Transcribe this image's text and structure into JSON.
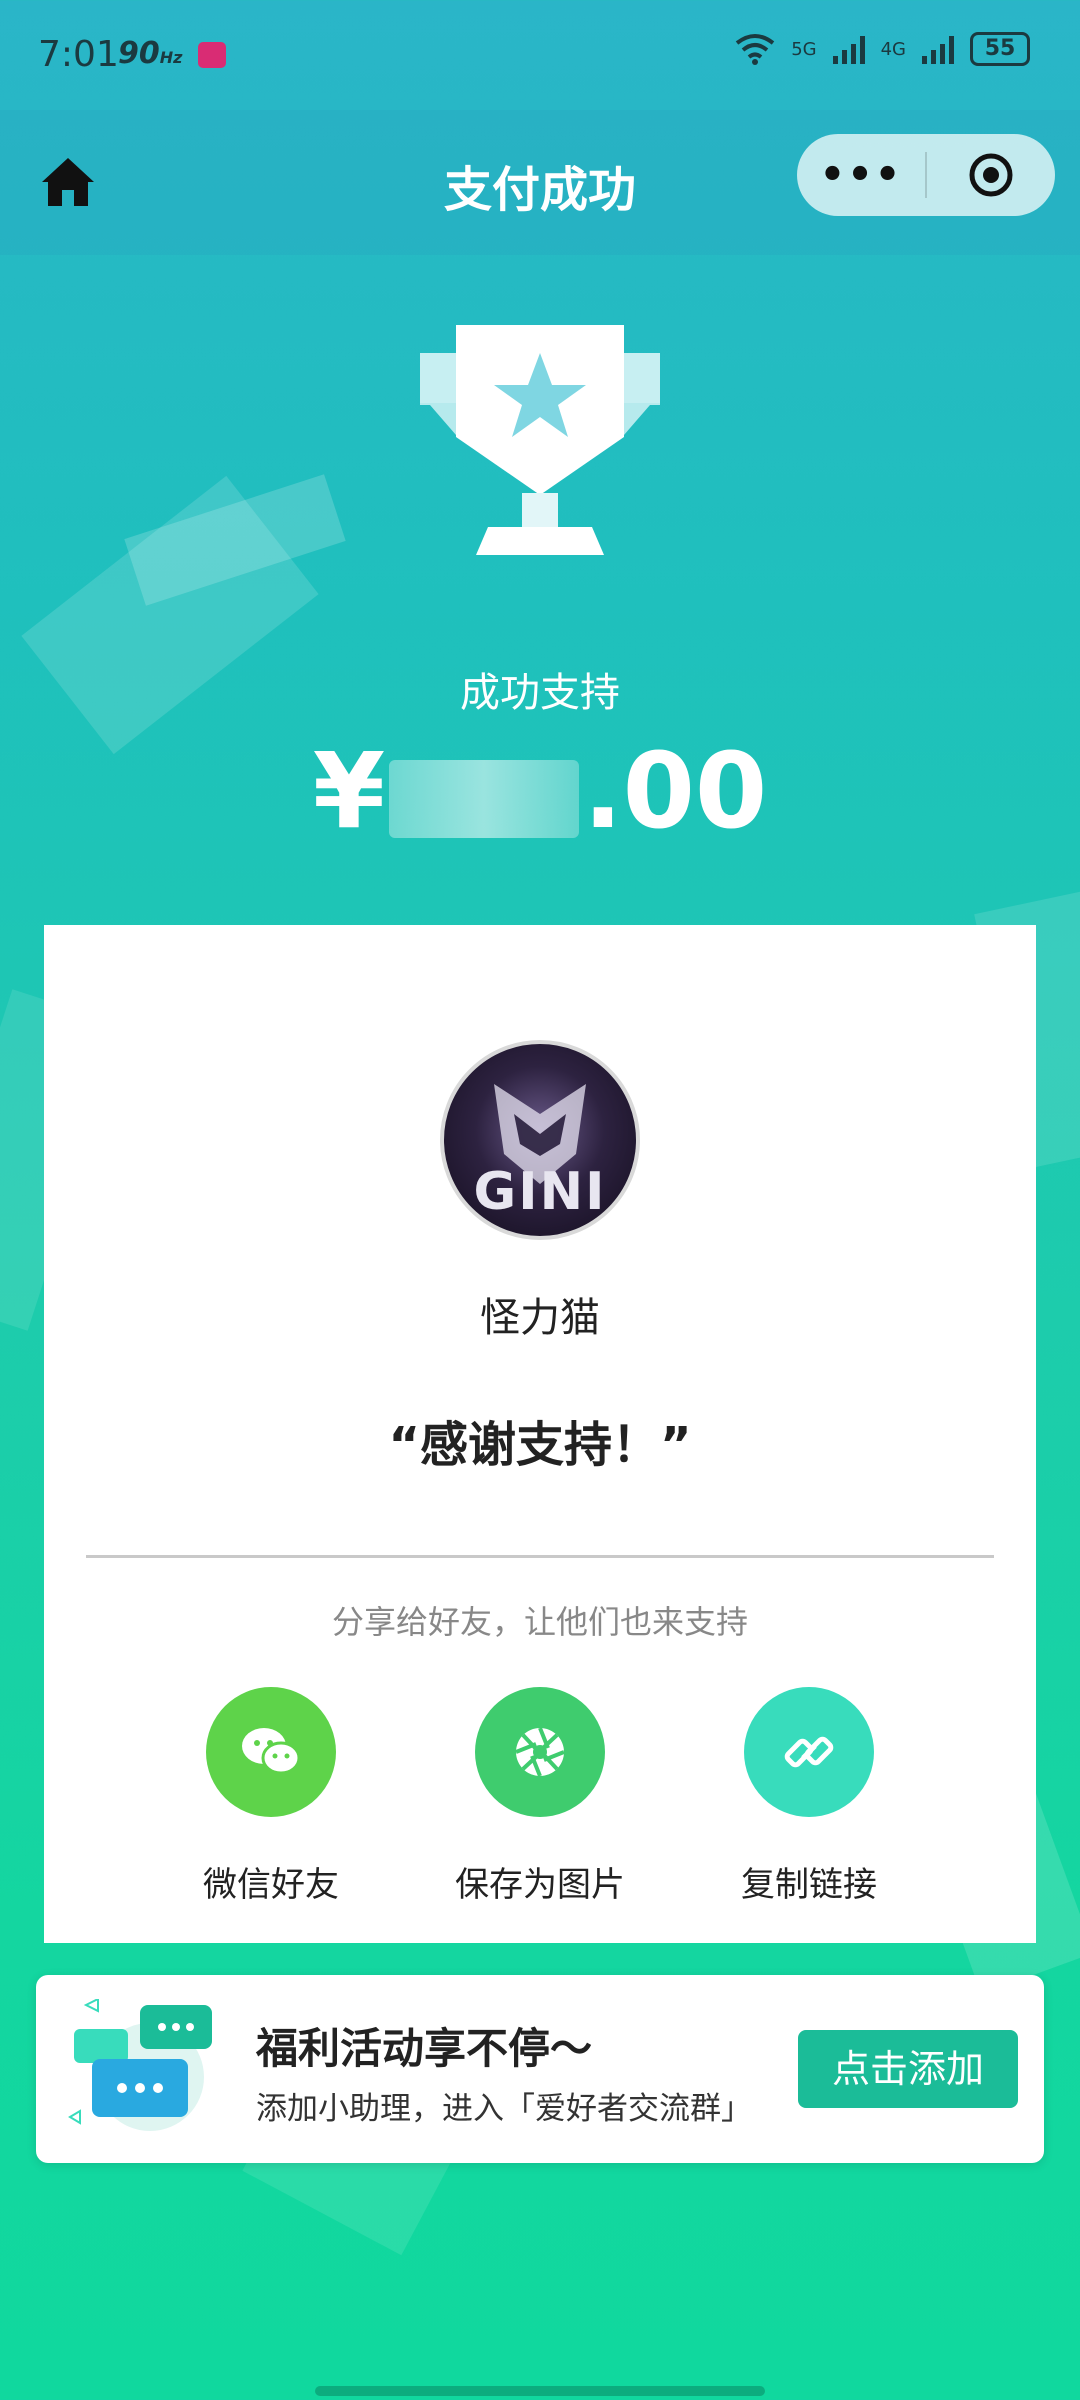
{
  "status_bar": {
    "time": "7:01",
    "refresh_rate": "90",
    "refresh_unit": "Hz",
    "net1": "5G",
    "net2": "4G",
    "battery": "55"
  },
  "nav": {
    "title": "支付成功",
    "more_label": "•••"
  },
  "result": {
    "support_label": "成功支持",
    "currency_symbol": "¥",
    "amount_suffix": ".00"
  },
  "card": {
    "avatar_text": "GINI",
    "creator_name": "怪力猫",
    "thanks_message": "“感谢支持！”",
    "share_hint": "分享给好友，让他们也来支持",
    "share_options": [
      {
        "label": "微信好友",
        "color": "#5ed34a",
        "icon": "wechat-icon"
      },
      {
        "label": "保存为图片",
        "color": "#3fcc6e",
        "icon": "aperture-icon"
      },
      {
        "label": "复制链接",
        "color": "#38dcbc",
        "icon": "link-icon"
      }
    ]
  },
  "banner": {
    "title": "福利活动享不停～",
    "subtitle": "添加小助理，进入「爱好者交流群」",
    "button_label": "点击添加"
  },
  "colors": {
    "accent": "#1bbc98",
    "wechat_green": "#5ed34a",
    "background_top": "#2ab5c8",
    "background_bottom": "#10d89e"
  }
}
